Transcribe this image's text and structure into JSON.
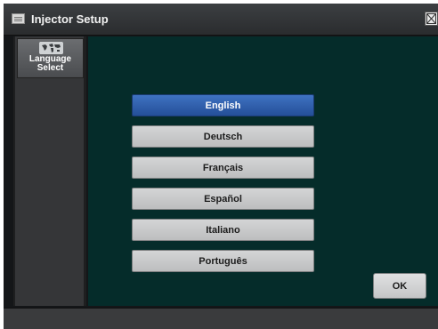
{
  "window": {
    "title": "Injector Setup",
    "title_icon": "settings-list-icon",
    "close_icon": "close-icon"
  },
  "sidebar": {
    "items": [
      {
        "label": "Language Select",
        "icon": "world-map-icon",
        "selected": true
      }
    ]
  },
  "language_list": {
    "selected": "English",
    "options": [
      "English",
      "Deutsch",
      "Français",
      "Español",
      "Italiano",
      "Português"
    ]
  },
  "actions": {
    "ok_label": "OK"
  },
  "colors": {
    "main_background": "#052c2a",
    "selected_button": "#3f72c2",
    "button": "#c9cacb",
    "titlebar": "#2f3234"
  }
}
